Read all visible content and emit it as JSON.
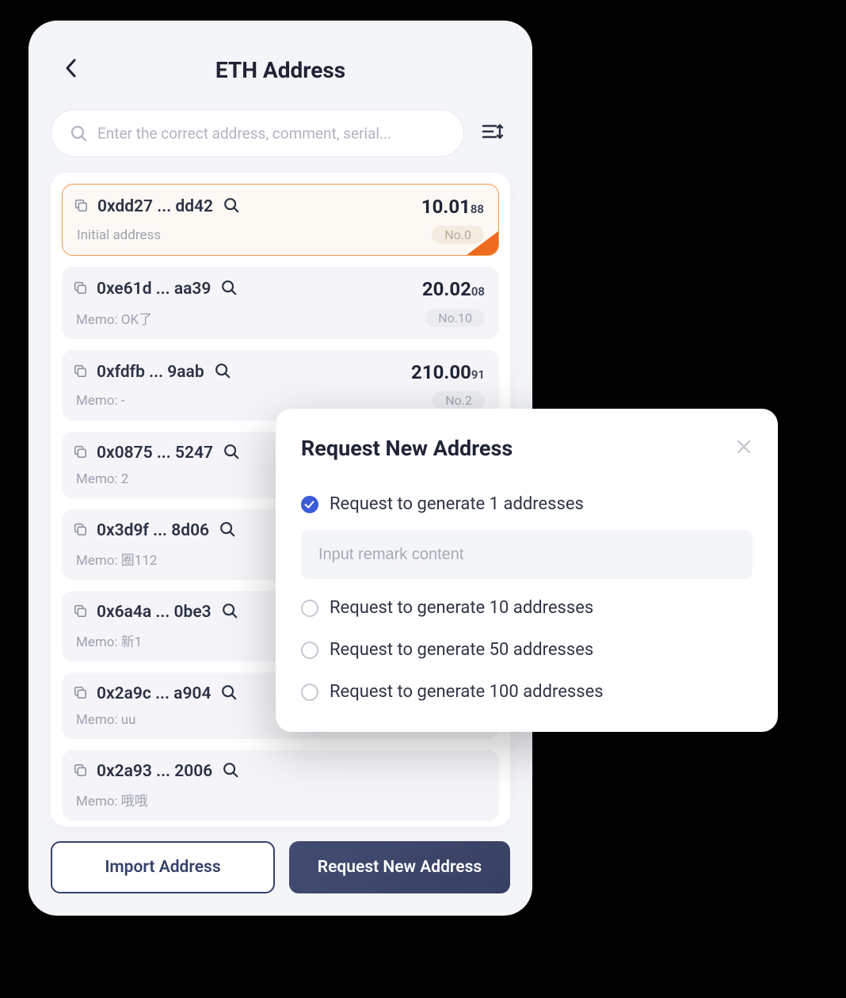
{
  "header": {
    "title": "ETH Address"
  },
  "search": {
    "placeholder": "Enter the correct address, comment, serial..."
  },
  "addresses": [
    {
      "addr": "0xdd27 ... dd42",
      "balance_main": "10.01",
      "balance_sub": "88",
      "memo": "Initial address",
      "no": "No.0",
      "selected": true
    },
    {
      "addr": "0xe61d ... aa39",
      "balance_main": "20.02",
      "balance_sub": "08",
      "memo": "Memo: OK了",
      "no": "No.10",
      "selected": false
    },
    {
      "addr": "0xfdfb ... 9aab",
      "balance_main": "210.00",
      "balance_sub": "91",
      "memo": "Memo: -",
      "no": "No.2",
      "selected": false
    },
    {
      "addr": "0x0875 ... 5247",
      "balance_main": "",
      "balance_sub": "",
      "memo": "Memo: 2",
      "no": "",
      "selected": false
    },
    {
      "addr": "0x3d9f ... 8d06",
      "balance_main": "",
      "balance_sub": "",
      "memo": "Memo: 圈112",
      "no": "",
      "selected": false
    },
    {
      "addr": "0x6a4a ... 0be3",
      "balance_main": "",
      "balance_sub": "",
      "memo": "Memo: 新1",
      "no": "",
      "selected": false
    },
    {
      "addr": "0x2a9c ... a904",
      "balance_main": "",
      "balance_sub": "",
      "memo": "Memo: uu",
      "no": "",
      "selected": false
    },
    {
      "addr": "0x2a93 ... 2006",
      "balance_main": "",
      "balance_sub": "",
      "memo": "Memo: 哦哦",
      "no": "",
      "selected": false
    }
  ],
  "footer": {
    "import_label": "Import Address",
    "request_label": "Request New Address"
  },
  "modal": {
    "title": "Request New Address",
    "options": [
      {
        "label": "Request to generate 1 addresses",
        "checked": true
      },
      {
        "label": "Request to generate 10 addresses",
        "checked": false
      },
      {
        "label": "Request to generate 50 addresses",
        "checked": false
      },
      {
        "label": "Request to generate 100 addresses",
        "checked": false
      }
    ],
    "remark_placeholder": "Input remark content"
  }
}
